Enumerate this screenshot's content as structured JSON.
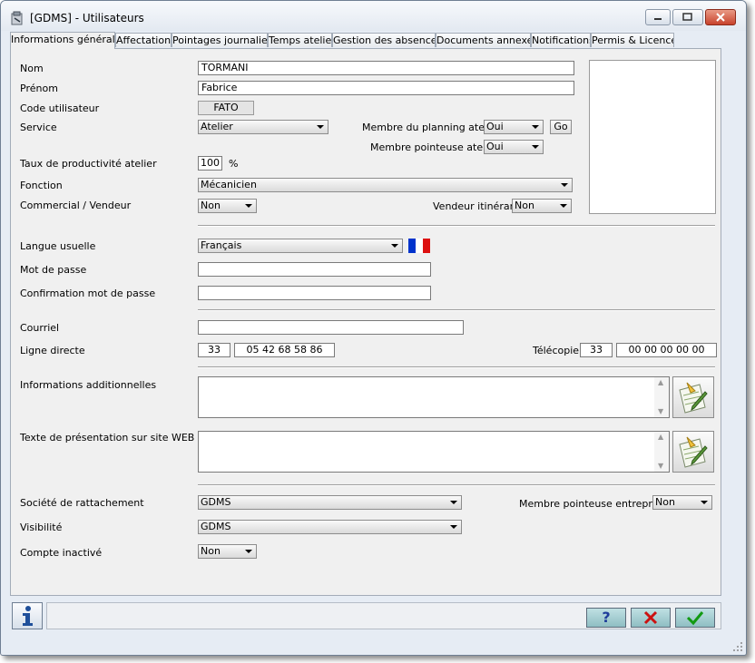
{
  "window": {
    "title": "[GDMS] - Utilisateurs"
  },
  "tabs": [
    {
      "label": "Informations générales",
      "active": true
    },
    {
      "label": "Affectations"
    },
    {
      "label": "Pointages journaliers"
    },
    {
      "label": "Temps atelier"
    },
    {
      "label": "Gestion des absences"
    },
    {
      "label": "Documents annexes"
    },
    {
      "label": "Notifications"
    },
    {
      "label": "Permis & Licences"
    }
  ],
  "form": {
    "nom": {
      "label": "Nom",
      "value": "TORMANI"
    },
    "prenom": {
      "label": "Prénom",
      "value": "Fabrice"
    },
    "code": {
      "label": "Code utilisateur",
      "value": "FATO"
    },
    "service": {
      "label": "Service",
      "value": "Atelier"
    },
    "membre_planning": {
      "label": "Membre du planning atelier",
      "value": "Oui",
      "go_label": "Go"
    },
    "membre_pointeuse_atelier": {
      "label": "Membre pointeuse atelier",
      "value": "Oui"
    },
    "taux": {
      "label": "Taux de productivité atelier",
      "value": "100",
      "unit": "%"
    },
    "fonction": {
      "label": "Fonction",
      "value": "Mécanicien"
    },
    "commercial": {
      "label": "Commercial / Vendeur",
      "value": "Non"
    },
    "vendeur_itinerant": {
      "label": "Vendeur itinérant",
      "value": "Non"
    },
    "langue": {
      "label": "Langue usuelle",
      "value": "Français"
    },
    "mot_de_passe": {
      "label": "Mot de passe",
      "value": ""
    },
    "confirmation": {
      "label": "Confirmation mot de passe",
      "value": ""
    },
    "courriel": {
      "label": "Courriel",
      "value": ""
    },
    "ligne_directe": {
      "label": "Ligne directe",
      "prefix": "33",
      "number": "05 42 68 58 86"
    },
    "telecopie": {
      "label": "Télécopie",
      "prefix": "33",
      "number": "00 00 00 00 00"
    },
    "infos_additionnelles": {
      "label": "Informations additionnelles",
      "value": ""
    },
    "texte_web": {
      "label": "Texte de présentation sur site WEB",
      "value": ""
    },
    "societe": {
      "label": "Société de rattachement",
      "value": "GDMS"
    },
    "membre_pointeuse_entreprise": {
      "label": "Membre pointeuse entreprise",
      "value": "Non"
    },
    "visibilite": {
      "label": "Visibilité",
      "value": "GDMS"
    },
    "compte_inactif": {
      "label": "Compte inactivé",
      "value": "Non"
    }
  },
  "icons": {
    "app": "app-icon",
    "flag": "french-flag-icon",
    "edit": "edit-document-icon",
    "info": "info-icon",
    "help": "help-icon",
    "cancel": "cancel-icon",
    "ok": "ok-icon"
  },
  "colors": {
    "flag_blue": "#0033cc",
    "flag_red": "#dd1111",
    "cancel_red": "#cc1111",
    "ok_green": "#129a12",
    "button_teal": "#9cc6cb"
  }
}
